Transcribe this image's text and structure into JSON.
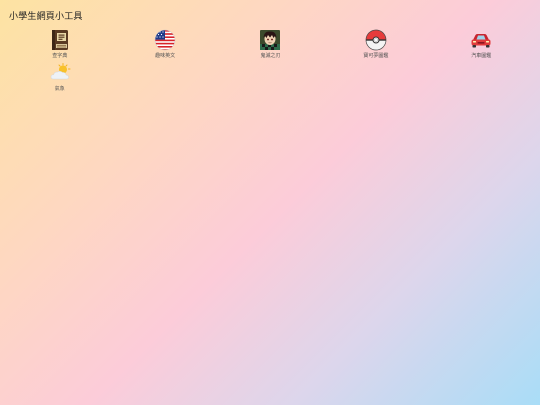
{
  "page": {
    "title": "小學生網頁小工具"
  },
  "apps": [
    {
      "label": "查字典",
      "icon": "dictionary-book-icon"
    },
    {
      "label": "趣味英文",
      "icon": "us-flag-icon"
    },
    {
      "label": "鬼滅之刃",
      "icon": "anime-character-icon"
    },
    {
      "label": "寶可夢圖鑑",
      "icon": "pokeball-icon"
    },
    {
      "label": "汽車圖鑑",
      "icon": "red-car-icon"
    },
    {
      "label": "氣象",
      "icon": "sun-cloud-icon"
    }
  ],
  "colors": {
    "gradient": [
      "#fde3a2",
      "#fcccd9",
      "#a9ddf7"
    ],
    "title_text": "#222222",
    "label_text": "#555555"
  }
}
